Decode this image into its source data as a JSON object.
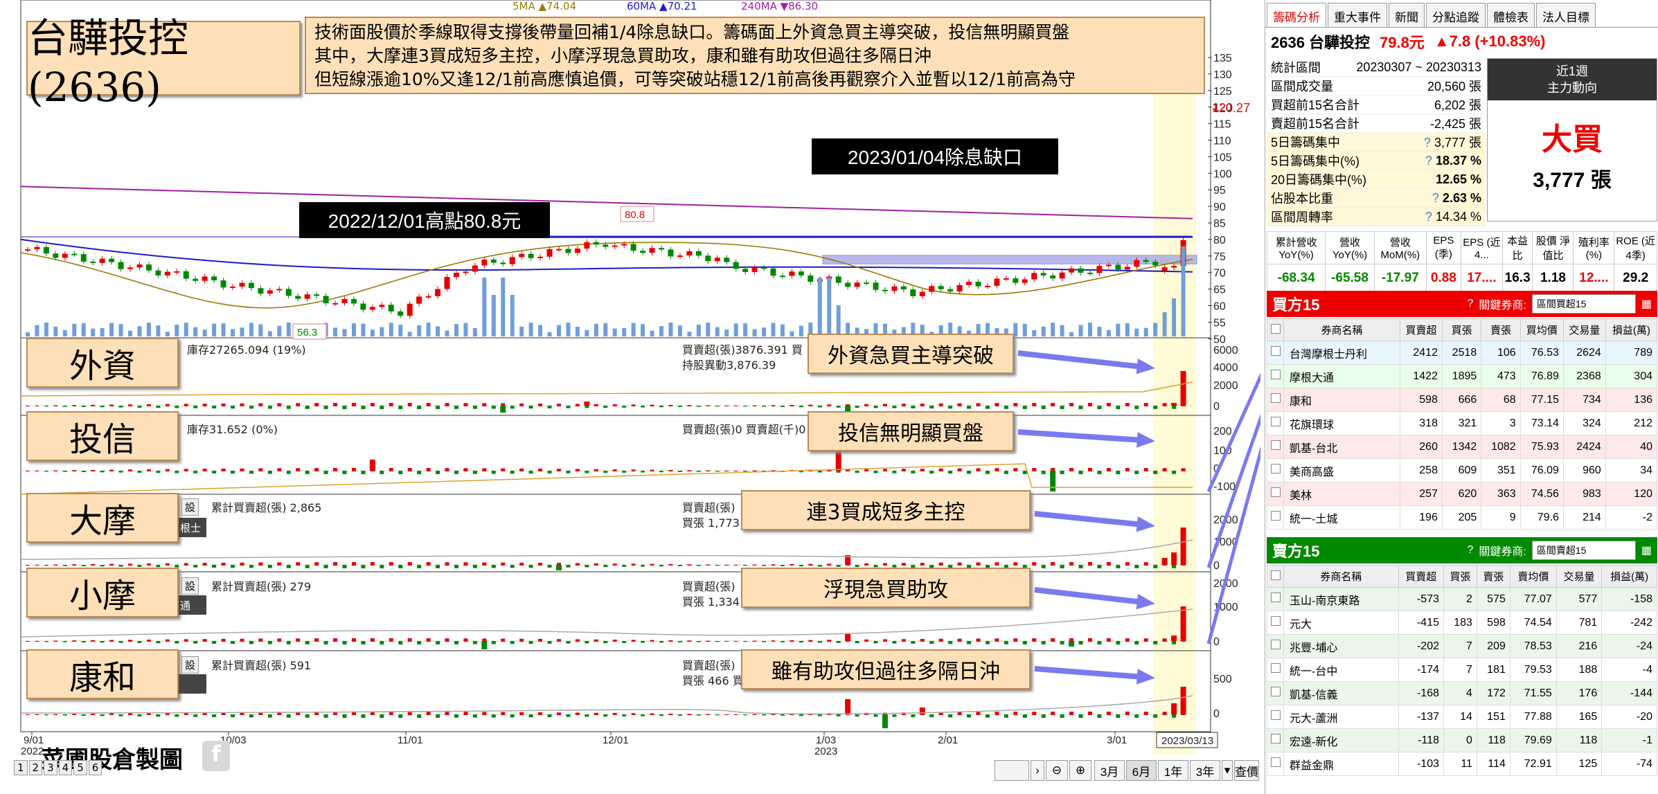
{
  "title": "台驊投控(2636)",
  "summary": [
    "技術面股價於季線取得支撐後帶量回補1/4除息缺口。籌碼面上外資急買主導突破，投信無明顯買盤",
    "其中，大摩連3買成短多主控，小摩浮現急買助攻，康和雖有助攻但過往多隔日沖",
    "但短線漲逾10%又逢12/1前高應慎追價，可等突破站穩12/1前高後再觀察介入並暫以12/1前高為守"
  ],
  "legend": {
    "ma5": "5MA ▲74.04",
    "ma60": "60MA ▲70.21",
    "ma240": "240MA ▼86.30"
  },
  "colors": {
    "up": "#e60000",
    "down": "#008800",
    "ma5": "#9a7a00",
    "ma60": "#1a1acc",
    "ma240": "#a020a0",
    "vol": "#6f9fd8",
    "highlight": "#fffbd6",
    "label_bg": "#fde0b8",
    "buy_header": "#ee0000",
    "sell_header": "#008a00"
  },
  "annotations": {
    "ex_div_gap": "2023/01/04除息缺口",
    "prev_high": "2022/12/01高點80.8元",
    "high_tag": "80.8",
    "low_tag": "56.3",
    "last_price_tag": "120.27"
  },
  "price_axis": [
    "135",
    "130",
    "125",
    "120",
    "115",
    "110",
    "105",
    "100",
    "95",
    "90",
    "85",
    "80",
    "75",
    "70",
    "65",
    "60",
    "55",
    "50"
  ],
  "panels": {
    "foreign": {
      "label": "外資",
      "info": "庫存27265.094 (19%)",
      "mid1": "買賣超(張)3876.391 買",
      "mid2": "持股異動3,876.39",
      "note": "外資急買主導突破",
      "ticks": [
        "6000",
        "4000",
        "2000",
        "0"
      ]
    },
    "trust": {
      "label": "投信",
      "info": "庫存31.652 (0%)",
      "mid1": "買賣超(張)0 買賣超(千)0",
      "note": "投信無明顯買盤",
      "ticks": [
        "200",
        "100",
        "0",
        "-100"
      ]
    },
    "ms": {
      "label": "大摩",
      "info": "累計買賣超(張) 2,865",
      "mid1": "買賣超(張)",
      "mid2": "買張 1,773",
      "btn": "設",
      "tag": "根士",
      "note": "連3買成短多主控",
      "ticks": [
        "2000",
        "1000",
        "0"
      ]
    },
    "jp": {
      "label": "小摩",
      "info": "累計買賣超(張) 279",
      "mid1": "買賣超(張)",
      "mid2": "買張 1,334",
      "btn": "設",
      "tag": "通",
      "note": "浮現急買助攻",
      "ticks": [
        "2000",
        "1000",
        "0"
      ]
    },
    "kh": {
      "label": "康和",
      "info": "累計買賣超(張) 591",
      "mid1": "買賣超(張)",
      "mid2": "買張 466 買",
      "btn": "設",
      "note": "雖有助攻但過往多隔日沖",
      "ticks": [
        "500",
        "0"
      ]
    }
  },
  "x_axis": {
    "labels": [
      "9/01",
      "10/03",
      "11/01",
      "12/01",
      "1/03",
      "2/01",
      "3/01"
    ],
    "year_labels": [
      "2022",
      "2023"
    ],
    "current": "2023/03/13"
  },
  "bottom": {
    "watermark": "菜圃股倉製圖",
    "page_nums": [
      "1",
      "2",
      "3",
      "4",
      "5",
      "6"
    ],
    "periods": [
      "3月",
      "6月",
      "1年",
      "3年"
    ],
    "query": "查價"
  },
  "side": {
    "tabs": [
      "籌碼分析",
      "重大事件",
      "新聞",
      "分點追蹤",
      "體檢表",
      "法人目標"
    ],
    "quote": {
      "name": "2636 台驊投控",
      "price": "79.8元",
      "change": "▲7.8 (+10.83%)"
    },
    "stats": [
      {
        "k": "統計區間",
        "v": "20230307 ~ 20230313"
      },
      {
        "k": "區間成交量",
        "v": "20,560 張"
      },
      {
        "k": "買超前15名合計",
        "v": "6,202 張"
      },
      {
        "k": "賣超前15名合計",
        "v": "-2,425 張"
      },
      {
        "k": "5日籌碼集中",
        "q": "?",
        "v": "3,777 張"
      },
      {
        "k": "5日籌碼集中(%)",
        "q": "?",
        "v": "18.37 %"
      },
      {
        "k": "20日籌碼集中(%)",
        "v": "12.65 %"
      },
      {
        "k": "佔股本比重",
        "q": "?",
        "v": "2.63 %"
      },
      {
        "k": "區間周轉率",
        "q": "?",
        "v": "14.34 %"
      }
    ],
    "mainforce": {
      "period": "近1週",
      "label": "主力動向",
      "verdict": "大買",
      "amount": "3,777 張"
    },
    "fin_headers": [
      "累計營收 YoY(%)",
      "營收 YoY(%)",
      "營收 MoM(%)",
      "EPS (季)",
      "EPS (近4...",
      "本益比",
      "股價 淨值比",
      "殖利率 (%)",
      "ROE (近4季)"
    ],
    "fin_values": [
      "-68.34",
      "-65.58",
      "-17.97",
      "0.88",
      "17....",
      "16.3",
      "1.18",
      "12....",
      "29.2"
    ],
    "buy": {
      "title": "買方15",
      "key_label": "關鍵券商:",
      "select": "區間買超15",
      "headers": [
        "券商名稱",
        "買賣超",
        "買張",
        "賣張",
        "買均價",
        "交易量",
        "損益(萬)"
      ],
      "rows": [
        [
          "台灣摩根士丹利",
          "2412",
          "2518",
          "106",
          "76.53",
          "2624",
          "789"
        ],
        [
          "摩根大通",
          "1422",
          "1895",
          "473",
          "76.89",
          "2368",
          "304"
        ],
        [
          "康和",
          "598",
          "666",
          "68",
          "77.15",
          "734",
          "136"
        ],
        [
          "花旗環球",
          "318",
          "321",
          "3",
          "73.14",
          "324",
          "212"
        ],
        [
          "凱基-台北",
          "260",
          "1342",
          "1082",
          "75.93",
          "2424",
          "40"
        ],
        [
          "美商高盛",
          "258",
          "609",
          "351",
          "76.09",
          "960",
          "34"
        ],
        [
          "美林",
          "257",
          "620",
          "363",
          "74.56",
          "983",
          "120"
        ],
        [
          "統一-土城",
          "196",
          "205",
          "9",
          "79.6",
          "214",
          "-2"
        ]
      ]
    },
    "sell": {
      "title": "賣方15",
      "key_label": "關鍵券商:",
      "select": "區間賣超15",
      "headers": [
        "券商名稱",
        "買賣超",
        "買張",
        "賣張",
        "賣均價",
        "交易量",
        "損益(萬)"
      ],
      "rows": [
        [
          "玉山-南京東路",
          "-573",
          "2",
          "575",
          "77.07",
          "577",
          "-158"
        ],
        [
          "元大",
          "-415",
          "183",
          "598",
          "74.54",
          "781",
          "-242"
        ],
        [
          "兆豐-埔心",
          "-202",
          "7",
          "209",
          "78.53",
          "216",
          "-24"
        ],
        [
          "統一-台中",
          "-174",
          "7",
          "181",
          "79.53",
          "188",
          "-4"
        ],
        [
          "凱基-信義",
          "-168",
          "4",
          "172",
          "71.55",
          "176",
          "-144"
        ],
        [
          "元大-蘆洲",
          "-137",
          "14",
          "151",
          "77.88",
          "165",
          "-20"
        ],
        [
          "宏遠-新化",
          "-118",
          "0",
          "118",
          "79.69",
          "118",
          "-1"
        ],
        [
          "群益金鼎",
          "-103",
          "11",
          "114",
          "72.91",
          "125",
          "-74"
        ]
      ]
    }
  }
}
